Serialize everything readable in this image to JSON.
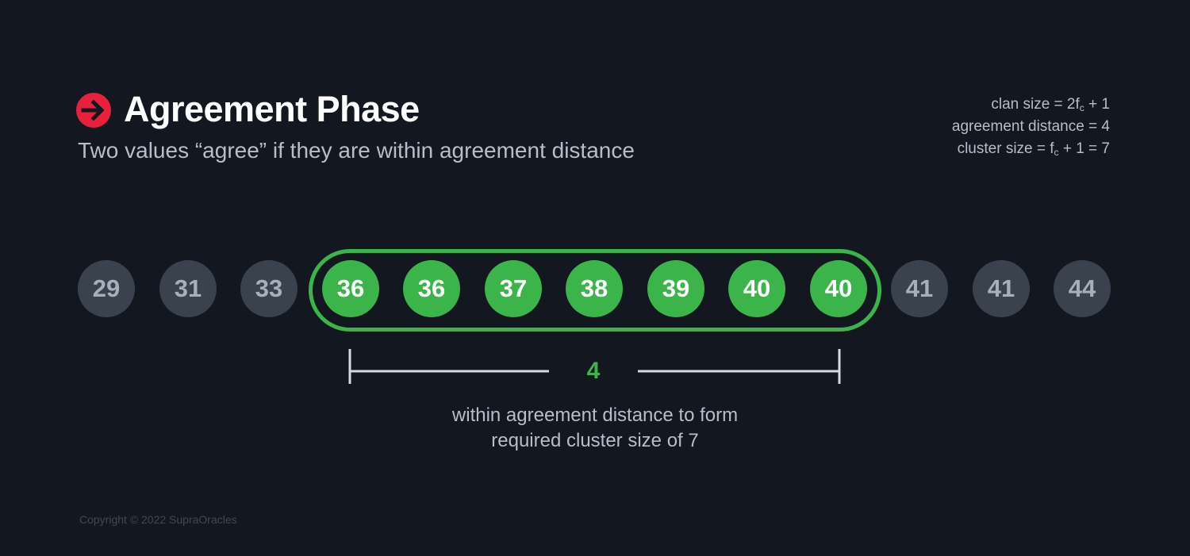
{
  "header": {
    "icon": "arrow-right-circle-icon",
    "icon_color": "#e8203c",
    "title": "Agreement Phase",
    "subtitle": "Two values “agree” if they are within agreement distance"
  },
  "formulas": {
    "clan_size": {
      "prefix": "clan size = 2f",
      "subscript": "c",
      "suffix": " + 1"
    },
    "agreement_distance": "agreement distance = 4",
    "cluster_size": {
      "prefix": "cluster size = f",
      "subscript": "c",
      "suffix": " + 1 = 7"
    }
  },
  "values": [
    {
      "value": "29",
      "in_cluster": false
    },
    {
      "value": "31",
      "in_cluster": false
    },
    {
      "value": "33",
      "in_cluster": false
    },
    {
      "value": "36",
      "in_cluster": true
    },
    {
      "value": "36",
      "in_cluster": true
    },
    {
      "value": "37",
      "in_cluster": true
    },
    {
      "value": "38",
      "in_cluster": true
    },
    {
      "value": "39",
      "in_cluster": true
    },
    {
      "value": "40",
      "in_cluster": true
    },
    {
      "value": "40",
      "in_cluster": true
    },
    {
      "value": "41",
      "in_cluster": false
    },
    {
      "value": "41",
      "in_cluster": false
    },
    {
      "value": "44",
      "in_cluster": false
    }
  ],
  "span": {
    "value": "4",
    "caption_line1": "within agreement distance to form",
    "caption_line2": "required cluster size of 7"
  },
  "colors": {
    "background": "#131720",
    "accent_green": "#3bb54a",
    "node_grey": "#3a424d",
    "text_muted": "#b7bec9"
  },
  "footer": {
    "copyright": "Copyright © 2022 SupraOracles"
  }
}
